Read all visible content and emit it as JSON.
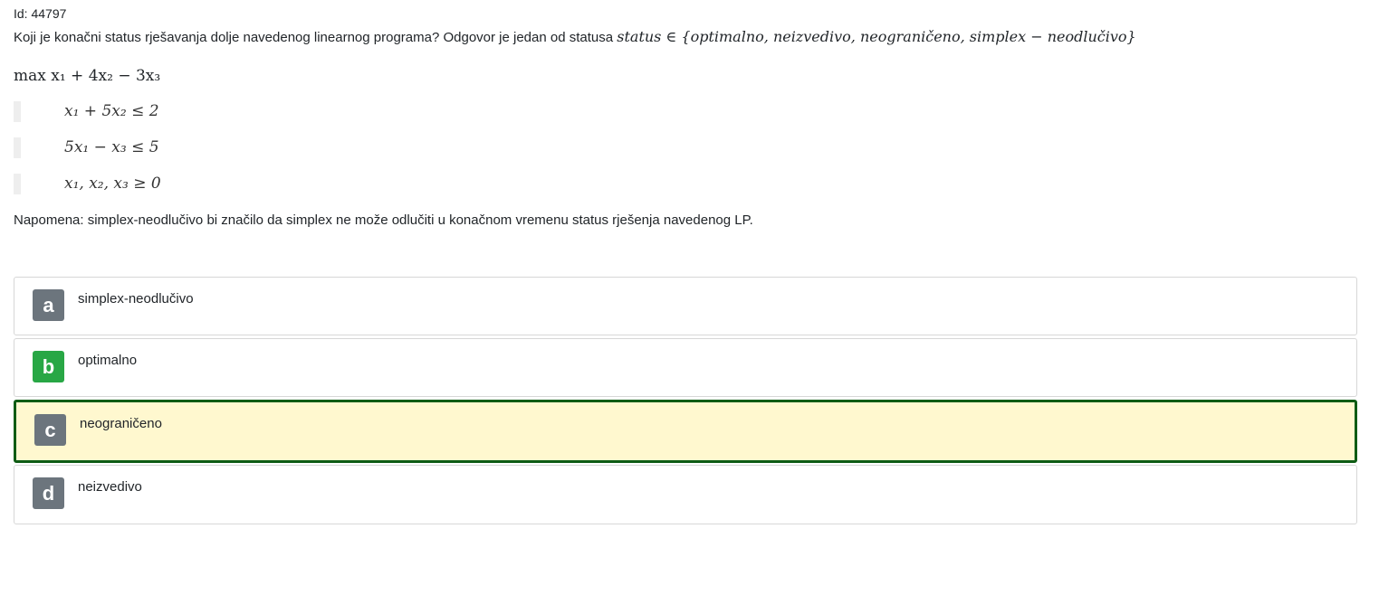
{
  "question": {
    "id_label": "Id: 44797",
    "text": "Koji je konačni status rješavanja dolje navedenog linearnog programa? Odgovor je jedan od statusa ",
    "status_set": "status ∈ {optimalno, neizvedivo, neograničeno, simplex − neodlučivo}",
    "objective": "max x₁ + 4x₂ − 3x₃",
    "constraints": [
      "x₁ + 5x₂ ≤ 2",
      "5x₁ − x₃ ≤ 5",
      "x₁, x₂, x₃ ≥ 0"
    ],
    "note": "Napomena: simplex-neodlučivo bi značilo da simplex ne može odlučiti u konačnom vremenu status rješenja navedenog LP."
  },
  "options": [
    {
      "letter": "a",
      "label": "simplex-neodlučivo",
      "state": "neutral"
    },
    {
      "letter": "b",
      "label": "optimalno",
      "state": "correct"
    },
    {
      "letter": "c",
      "label": "neograničeno",
      "state": "selected"
    },
    {
      "letter": "d",
      "label": "neizvedivo",
      "state": "neutral"
    }
  ],
  "colors": {
    "neutral_letter_bg": "#6c757d",
    "correct_letter_bg": "#28a745",
    "selected_bg": "#fff8cf",
    "selected_border": "#0e5c14"
  }
}
